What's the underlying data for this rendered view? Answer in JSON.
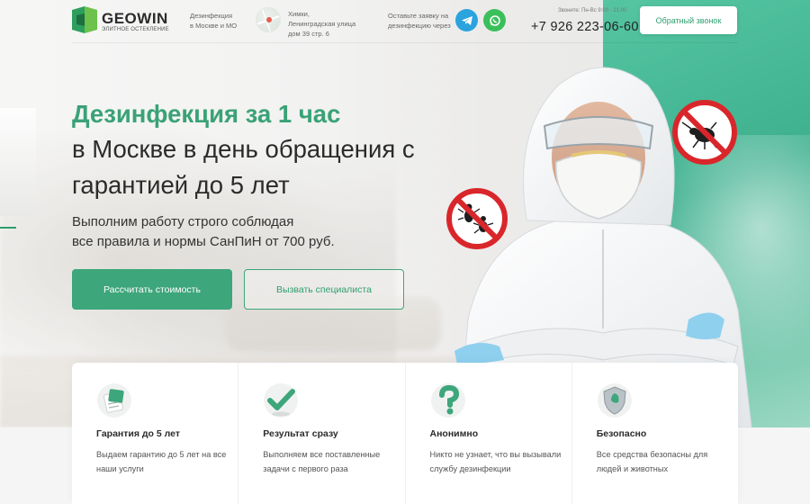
{
  "header": {
    "logo_name": "GEOWIN",
    "logo_tagline": "ЭЛИТНОЕ ОСТЕКЛЕНИЕ",
    "service_line1": "Дезинфекция",
    "service_line2": "в Москве и МО",
    "address_line1": "Химки,",
    "address_line2": "Ленинградская улица",
    "address_line3": "дом 39 стр. 6",
    "request_line1": "Оставьте заявку на",
    "request_line2": "дезинфекцию через",
    "hours": "Звоните: Пн-Вс 9:00 - 21:00",
    "phone": "+7 926 223-06-60",
    "callback_label": "Обратный звонок"
  },
  "hero": {
    "title_accent": "Дезинфекция за 1 час",
    "title_line2": "в Москве в день обращения с",
    "title_line3": "гарантией до 5 лет",
    "subtitle_line1": "Выполним работу строго соблюдая",
    "subtitle_line2": "все правила и нормы СанПиН от 700 руб.",
    "primary_button": "Рассчитать стоимость",
    "secondary_button": "Вызвать специалиста"
  },
  "features": [
    {
      "title": "Гарантия до 5 лет",
      "text": "Выдаем гарантию до 5 лет на все наши услуги",
      "icon": "certificate-icon"
    },
    {
      "title": "Результат сразу",
      "text": "Выполняем все поставленные задачи с первого раза",
      "icon": "checkmark-icon"
    },
    {
      "title": "Анонимно",
      "text": "Никто не узнает, что вы вызывали службу дезинфекции",
      "icon": "question-icon"
    },
    {
      "title": "Безопасно",
      "text": "Все средства безопасны для людей и животных",
      "icon": "shield-icon"
    }
  ],
  "colors": {
    "accent": "#3da67b",
    "teal_bg": "#3eb08e",
    "telegram": "#2ba3de",
    "whatsapp": "#3bbf5a",
    "stop_red": "#d9262b"
  }
}
